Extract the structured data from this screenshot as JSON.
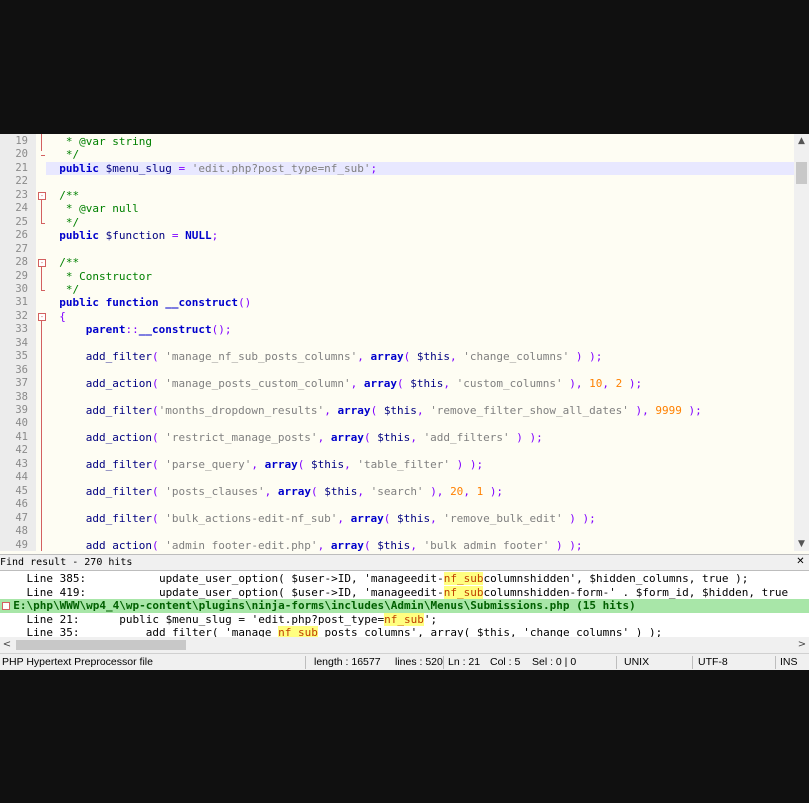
{
  "editor": {
    "current_line": 21,
    "lines": [
      {
        "n": "19",
        "html": "   <span class='cm'>* @var string</span>"
      },
      {
        "n": "20",
        "html": "   <span class='cm'>*/</span>"
      },
      {
        "n": "21",
        "html": "  <span class='kw'>public</span> <span class='var'>$menu_slug</span> <span class='op'>=</span> <span class='str'>'edit.php?post_type=nf_sub'</span><span class='op'>;</span>"
      },
      {
        "n": "22",
        "html": ""
      },
      {
        "n": "23",
        "html": "  <span class='cm'>/**</span>"
      },
      {
        "n": "24",
        "html": "   <span class='cm'>* @var null</span>"
      },
      {
        "n": "25",
        "html": "   <span class='cm'>*/</span>"
      },
      {
        "n": "26",
        "html": "  <span class='kw'>public</span> <span class='var'>$function</span> <span class='op'>=</span> <span class='kw'>NULL</span><span class='op'>;</span>"
      },
      {
        "n": "27",
        "html": ""
      },
      {
        "n": "28",
        "html": "  <span class='cm'>/**</span>"
      },
      {
        "n": "29",
        "html": "   <span class='cm'>* Constructor</span>"
      },
      {
        "n": "30",
        "html": "   <span class='cm'>*/</span>"
      },
      {
        "n": "31",
        "html": "  <span class='kw'>public function __construct</span><span class='op'>()</span>"
      },
      {
        "n": "32",
        "html": "  <span class='op'>{</span>"
      },
      {
        "n": "33",
        "html": "      <span class='kw'>parent</span><span class='op'>::</span><span class='kw'>__construct</span><span class='op'>();</span>"
      },
      {
        "n": "34",
        "html": ""
      },
      {
        "n": "35",
        "html": "      <span class='fn'>add_filter</span><span class='op'>(</span> <span class='str'>'manage_nf_sub_posts_columns'</span><span class='op'>,</span> <span class='kw'>array</span><span class='op'>(</span> <span class='var'>$this</span><span class='op'>,</span> <span class='str'>'change_columns'</span> <span class='op'>) );</span>"
      },
      {
        "n": "36",
        "html": ""
      },
      {
        "n": "37",
        "html": "      <span class='fn'>add_action</span><span class='op'>(</span> <span class='str'>'manage_posts_custom_column'</span><span class='op'>,</span> <span class='kw'>array</span><span class='op'>(</span> <span class='var'>$this</span><span class='op'>,</span> <span class='str'>'custom_columns'</span> <span class='op'>),</span> <span class='num'>10</span><span class='op'>,</span> <span class='num'>2</span> <span class='op'>);</span>"
      },
      {
        "n": "38",
        "html": ""
      },
      {
        "n": "39",
        "html": "      <span class='fn'>add_filter</span><span class='op'>(</span><span class='str'>'months_dropdown_results'</span><span class='op'>,</span> <span class='kw'>array</span><span class='op'>(</span> <span class='var'>$this</span><span class='op'>,</span> <span class='str'>'remove_filter_show_all_dates'</span> <span class='op'>),</span> <span class='num'>9999</span> <span class='op'>);</span>"
      },
      {
        "n": "40",
        "html": ""
      },
      {
        "n": "41",
        "html": "      <span class='fn'>add_action</span><span class='op'>(</span> <span class='str'>'restrict_manage_posts'</span><span class='op'>,</span> <span class='kw'>array</span><span class='op'>(</span> <span class='var'>$this</span><span class='op'>,</span> <span class='str'>'add_filters'</span> <span class='op'>) );</span>"
      },
      {
        "n": "42",
        "html": ""
      },
      {
        "n": "43",
        "html": "      <span class='fn'>add_filter</span><span class='op'>(</span> <span class='str'>'parse_query'</span><span class='op'>,</span> <span class='kw'>array</span><span class='op'>(</span> <span class='var'>$this</span><span class='op'>,</span> <span class='str'>'table_filter'</span> <span class='op'>) );</span>"
      },
      {
        "n": "44",
        "html": ""
      },
      {
        "n": "45",
        "html": "      <span class='fn'>add_filter</span><span class='op'>(</span> <span class='str'>'posts_clauses'</span><span class='op'>,</span> <span class='kw'>array</span><span class='op'>(</span> <span class='var'>$this</span><span class='op'>,</span> <span class='str'>'search'</span> <span class='op'>),</span> <span class='num'>20</span><span class='op'>,</span> <span class='num'>1</span> <span class='op'>);</span>"
      },
      {
        "n": "46",
        "html": ""
      },
      {
        "n": "47",
        "html": "      <span class='fn'>add_filter</span><span class='op'>(</span> <span class='str'>'bulk_actions-edit-nf_sub'</span><span class='op'>,</span> <span class='kw'>array</span><span class='op'>(</span> <span class='var'>$this</span><span class='op'>,</span> <span class='str'>'remove_bulk_edit'</span> <span class='op'>) );</span>"
      },
      {
        "n": "48",
        "html": ""
      },
      {
        "n": "49",
        "html": "      <span class='fn'>add_action</span><span class='op'>(</span> <span class='str'>'admin_footer-edit.php'</span><span class='op'>,</span> <span class='kw'>array</span><span class='op'>(</span> <span class='var'>$this</span><span class='op'>,</span> <span class='str'>'bulk_admin_footer'</span> <span class='op'>) );</span>"
      }
    ]
  },
  "find_result": {
    "title": "Find result - 270 hits",
    "close_label": "✕",
    "rows": [
      {
        "type": "hit",
        "html": "    Line 385:           update_user_option( $user->ID, 'manageedit-<span class='hit'>nf_sub</span>columnshidden', $hidden_columns, true );"
      },
      {
        "type": "hit",
        "html": "    Line 419:           update_user_option( $user->ID, 'manageedit-<span class='hit'>nf_sub</span>columnshidden-form-' . $form_id, $hidden, true"
      },
      {
        "type": "file",
        "html": "  E:\\php\\WWW\\wp4_4\\wp-content\\plugins\\ninja-forms\\includes\\Admin\\Menus\\Submissions.php (15 hits)"
      },
      {
        "type": "hit",
        "html": "    Line 21:      public $menu_slug = 'edit.php?post_type=<span class='hit'>nf_sub</span>';"
      },
      {
        "type": "hit",
        "html": "    Line 35:          add_filter( 'manage_<span class='hit'>nf_sub</span>_posts_columns', array( $this, 'change_columns' ) );"
      }
    ]
  },
  "statusbar": {
    "file_type": "PHP Hypertext Preprocessor file",
    "length": "length : 16577",
    "lines": "lines : 520",
    "ln": "Ln : 21",
    "col": "Col : 5",
    "sel": "Sel : 0 | 0",
    "eol": "UNIX",
    "encoding": "UTF-8",
    "mode": "INS"
  },
  "icons": {
    "scroll_up": "▲",
    "scroll_down": "▼",
    "scroll_left": "<",
    "scroll_right": ">"
  }
}
